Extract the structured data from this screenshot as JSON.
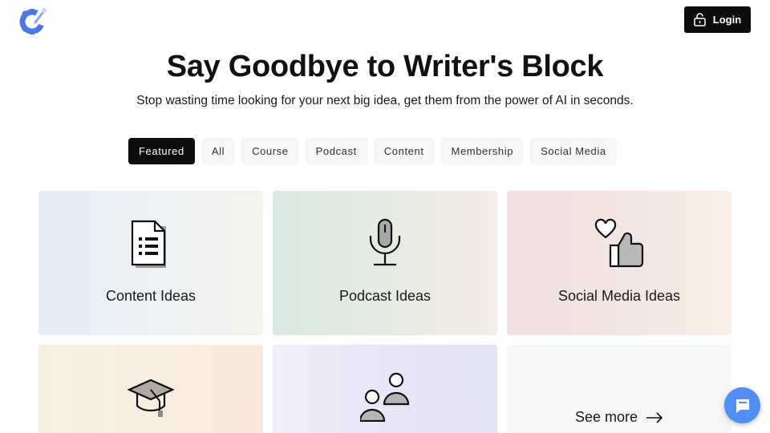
{
  "header": {
    "login_label": "Login"
  },
  "hero": {
    "title": "Say Goodbye to Writer's Block",
    "subtitle": "Stop wasting time looking for your next big idea, get them from the power of AI in seconds."
  },
  "tabs": [
    {
      "label": "Featured",
      "active": true
    },
    {
      "label": "All"
    },
    {
      "label": "Course"
    },
    {
      "label": "Podcast"
    },
    {
      "label": "Content"
    },
    {
      "label": "Membership"
    },
    {
      "label": "Social Media"
    }
  ],
  "cards": [
    {
      "label": "Content Ideas",
      "icon": "document-list-icon"
    },
    {
      "label": "Podcast Ideas",
      "icon": "microphone-icon"
    },
    {
      "label": "Social Media Ideas",
      "icon": "heart-thumbs-up-icon"
    },
    {
      "label": "",
      "icon": "graduation-cap-icon"
    },
    {
      "label": "",
      "icon": "people-icon"
    }
  ],
  "see_more": {
    "label": "See more"
  },
  "colors": {
    "primary": "#0d0d0d",
    "chat_accent": "#4f8ff7",
    "logo": "#4a78e8"
  }
}
